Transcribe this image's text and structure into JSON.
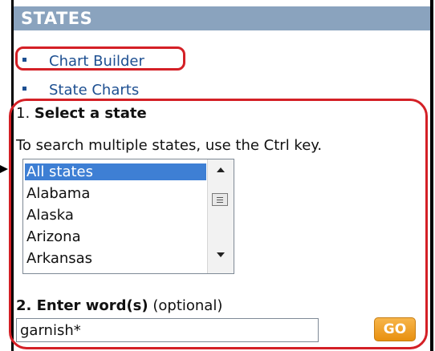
{
  "header": {
    "title": "STATES"
  },
  "nav": {
    "items": [
      {
        "label": "Chart Builder"
      },
      {
        "label": "State Charts"
      }
    ]
  },
  "step1": {
    "number": "1.",
    "title": "Select a state",
    "hint": "To search multiple states, use the Ctrl key."
  },
  "states_list": {
    "options": [
      "All states",
      "Alabama",
      "Alaska",
      "Arizona",
      "Arkansas"
    ],
    "selected": "All states"
  },
  "step2": {
    "title": "2. Enter word(s)",
    "optional": "(optional)"
  },
  "search": {
    "value": "garnish*"
  },
  "go_button": {
    "label": "GO"
  },
  "colors": {
    "header_bg": "#8aa3be",
    "link": "#1d4f91",
    "highlight_ring": "#d42026",
    "selected_option": "#3e7fd4",
    "go_button": "#f0a22e"
  }
}
